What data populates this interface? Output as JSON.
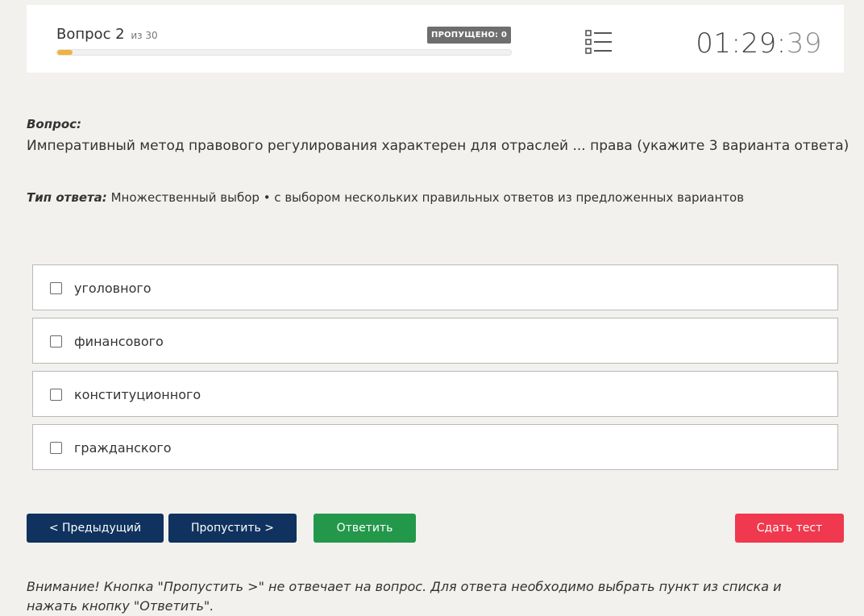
{
  "header": {
    "question_label": "Вопрос 2",
    "question_of": "из 30",
    "progress_fraction": 0.033,
    "skipped_badge": "ПРОПУЩЕНО: 0",
    "timer_main": "01:29:",
    "timer_seconds": "39",
    "colors": {
      "progress": "#f0b43c",
      "badge": "#6e6e6e"
    }
  },
  "question": {
    "label": "Вопрос:",
    "text": "Императивный метод правового регулирования характерен для отраслей ... права (укажите 3 варианта ответа)",
    "type_label": "Тип ответа:",
    "type_text": "Множественный выбор • с выбором нескольких правильных ответов из предложенных вариантов"
  },
  "options": [
    {
      "label": "уголовного",
      "checked": false
    },
    {
      "label": "финансового",
      "checked": false
    },
    {
      "label": "конституционного",
      "checked": false
    },
    {
      "label": "гражданского",
      "checked": false
    }
  ],
  "buttons": {
    "prev": "< Предыдущий",
    "skip": "Пропустить >",
    "answer": "Ответить",
    "submit": "Сдать тест",
    "colors": {
      "nav": "#10325e",
      "answer": "#23984b",
      "submit": "#f0384e"
    }
  },
  "notice": "Внимание! Кнопка \"Пропустить >\" не отвечает на вопрос. Для ответа необходимо выбрать пункт из списка и нажать кнопку \"Ответить\"."
}
